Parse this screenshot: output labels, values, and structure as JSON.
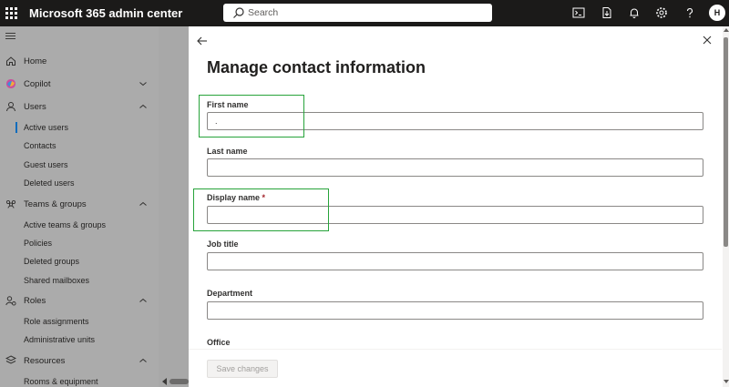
{
  "app": {
    "title": "Microsoft 365 admin center"
  },
  "search": {
    "placeholder": "Search"
  },
  "topbar": {
    "icons": [
      "terminal-icon",
      "download-icon",
      "bell-icon",
      "gear-icon",
      "help-icon"
    ],
    "avatar_initial": "H"
  },
  "sidebar": {
    "items": [
      {
        "label": "Home",
        "icon": "home-icon"
      },
      {
        "label": "Copilot",
        "icon": "copilot-icon",
        "expanded": false
      },
      {
        "label": "Users",
        "icon": "user-icon",
        "expanded": true
      },
      {
        "label": "Active users",
        "active": true
      },
      {
        "label": "Contacts"
      },
      {
        "label": "Guest users"
      },
      {
        "label": "Deleted users"
      },
      {
        "label": "Teams & groups",
        "icon": "teams-groups-icon",
        "expanded": true
      },
      {
        "label": "Active teams & groups"
      },
      {
        "label": "Policies"
      },
      {
        "label": "Deleted groups"
      },
      {
        "label": "Shared mailboxes"
      },
      {
        "label": "Roles",
        "icon": "roles-icon",
        "expanded": true
      },
      {
        "label": "Role assignments"
      },
      {
        "label": "Administrative units"
      },
      {
        "label": "Resources",
        "icon": "resources-icon",
        "expanded": true
      },
      {
        "label": "Rooms & equipment"
      }
    ]
  },
  "panel": {
    "title": "Manage contact information",
    "fields": [
      {
        "label": "First name",
        "value": ".",
        "required": false,
        "highlighted": true
      },
      {
        "label": "Last name",
        "value": "",
        "required": false,
        "highlighted": false
      },
      {
        "label": "Display name",
        "value": "",
        "required": true,
        "required_mark": "*",
        "highlighted": true
      },
      {
        "label": "Job title",
        "value": "",
        "required": false,
        "highlighted": false
      },
      {
        "label": "Department",
        "value": "",
        "required": false,
        "highlighted": false
      },
      {
        "label": "Office",
        "required": false
      }
    ],
    "save_label": "Save changes"
  },
  "colors": {
    "topbar": "#1b1a19",
    "accent": "#0f6cbd",
    "highlight": "#27a33a",
    "required": "#a4262c"
  }
}
